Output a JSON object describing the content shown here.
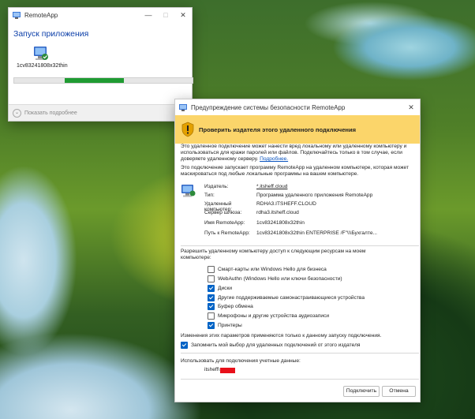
{
  "remoteapp": {
    "title": "RemoteApp",
    "heading": "Запуск приложения",
    "app_name": "1cv83241808x32thin",
    "progress": 0.33,
    "show_details": "Показать подробнее"
  },
  "security": {
    "title": "Предупреждение системы безопасности RemoteApp",
    "banner": "Проверить издателя этого удаленного подключения",
    "para1": "Это удаленное подключение может нанести вред локальному или удаленному компьютеру и использоваться для кражи паролей или файлов. Подключайтесь только в том случае, если доверяете удаленному серверу.",
    "para1_link": "Подробнее.",
    "para2": "Это подключение запускает программу RemoteApp на удаленном компьютере, которая может маскироваться под любые локальные программы на вашем компьютере.",
    "fields": [
      {
        "k": "Издатель:",
        "v": "*.itsheff.cloud",
        "link": true
      },
      {
        "k": "Тип:",
        "v": "Программа удаленного приложения RemoteApp"
      },
      {
        "k": "Удаленный компьютер:",
        "v": "RDHA3.ITSHEFF.CLOUD"
      },
      {
        "k": "Сервер шлюза:",
        "v": "rdha3.itsheff.cloud"
      },
      {
        "k": "Имя RemoteApp:",
        "v": "1cv83241808x32thin"
      },
      {
        "k": "Путь к RemoteApp:",
        "v": "1cv83241808x32thin ENTERPRISE /F\"\\\\\\Бухгалте..."
      }
    ],
    "allow_label": "Разрешить удаленному компьютеру доступ к следующим ресурсам на моем компьютере:",
    "resources": [
      {
        "label": "Смарт-карты или Windows Hello для бизнеса",
        "checked": false
      },
      {
        "label": "WebAuthn (Windows Hello или ключи безопасности)",
        "checked": false
      },
      {
        "label": "Диски",
        "checked": true
      },
      {
        "label": "Другие поддерживаемые самонастраивающиеся устройства",
        "checked": true
      },
      {
        "label": "Буфер обмена",
        "checked": true
      },
      {
        "label": "Микрофоны и другие устройства аудиозаписи",
        "checked": false
      },
      {
        "label": "Принтеры",
        "checked": true
      }
    ],
    "changes_note": "Изменения этих параметров применяются только к данному запуску подключения.",
    "remember_label": "Запомнить мой выбор для удаленных подключений от этого издателя",
    "remember_checked": true,
    "creds_label": "Использовать для подключения учетные данные:",
    "creds_user": "itsheff\\",
    "connect": "Подключить",
    "cancel": "Отмена"
  }
}
